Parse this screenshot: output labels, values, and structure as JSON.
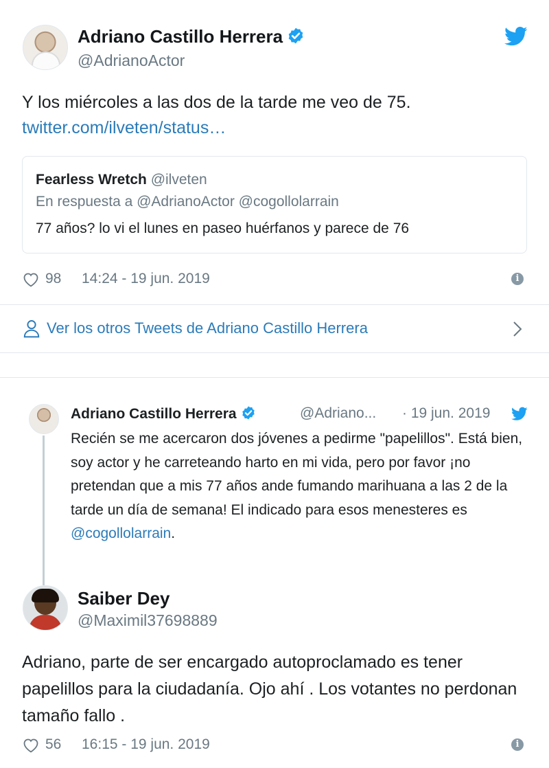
{
  "tweet": {
    "author_name": "Adriano Castillo Herrera",
    "author_handle": "@AdrianoActor",
    "text": "Y los miércoles a las dos de la tarde me veo de 75.",
    "link_text": "twitter.com/ilveten/status…",
    "likes": "98",
    "time": "14:24 - 19 jun. 2019",
    "icons": {
      "verified": "verified-badge-icon",
      "brand": "twitter-bird-icon",
      "like": "heart-icon",
      "info": "info-icon"
    },
    "quoted": {
      "author_name": "Fearless Wretch",
      "author_handle": "@ilveten",
      "reply_to": "En respuesta a @AdrianoActor @cogollolarrain",
      "text": "77 años? lo vi el lunes en paseo huérfanos y parece de 76"
    }
  },
  "more_tweets": {
    "label": "Ver los otros Tweets de Adriano Castillo Herrera",
    "icons": {
      "person": "person-icon",
      "chevron": "chevron-right-icon"
    }
  },
  "parent_tweet": {
    "author_name": "Adriano Castillo Herrera",
    "author_handle": "@Adriano...",
    "date": "· 19 jun. 2019",
    "text": "Recién se me acercaron dos jóvenes a pedirme \"papelillos\". Está bien, soy actor y he carreteando harto en mi vida, pero por favor ¡no pretendan que a mis 77 años ande fumando marihuana a las 2 de la tarde un día de semana! El indicado para esos menesteres es",
    "mention": "@cogollolarrain",
    "end_punct": "."
  },
  "reply_tweet": {
    "author_name": "Saiber Dey",
    "author_handle": "@Maximil37698889",
    "text": "Adriano, parte de ser encargado autoproclamado es tener papelillos para la ciudadanía. Ojo ahí . Los votantes no perdonan tamaño fallo .",
    "likes": "56",
    "time": "16:15 - 19 jun. 2019"
  },
  "colors": {
    "link": "#2b7bb9",
    "muted": "#697882",
    "border": "#e1e8ed",
    "twitter_blue": "#1da1f2"
  }
}
